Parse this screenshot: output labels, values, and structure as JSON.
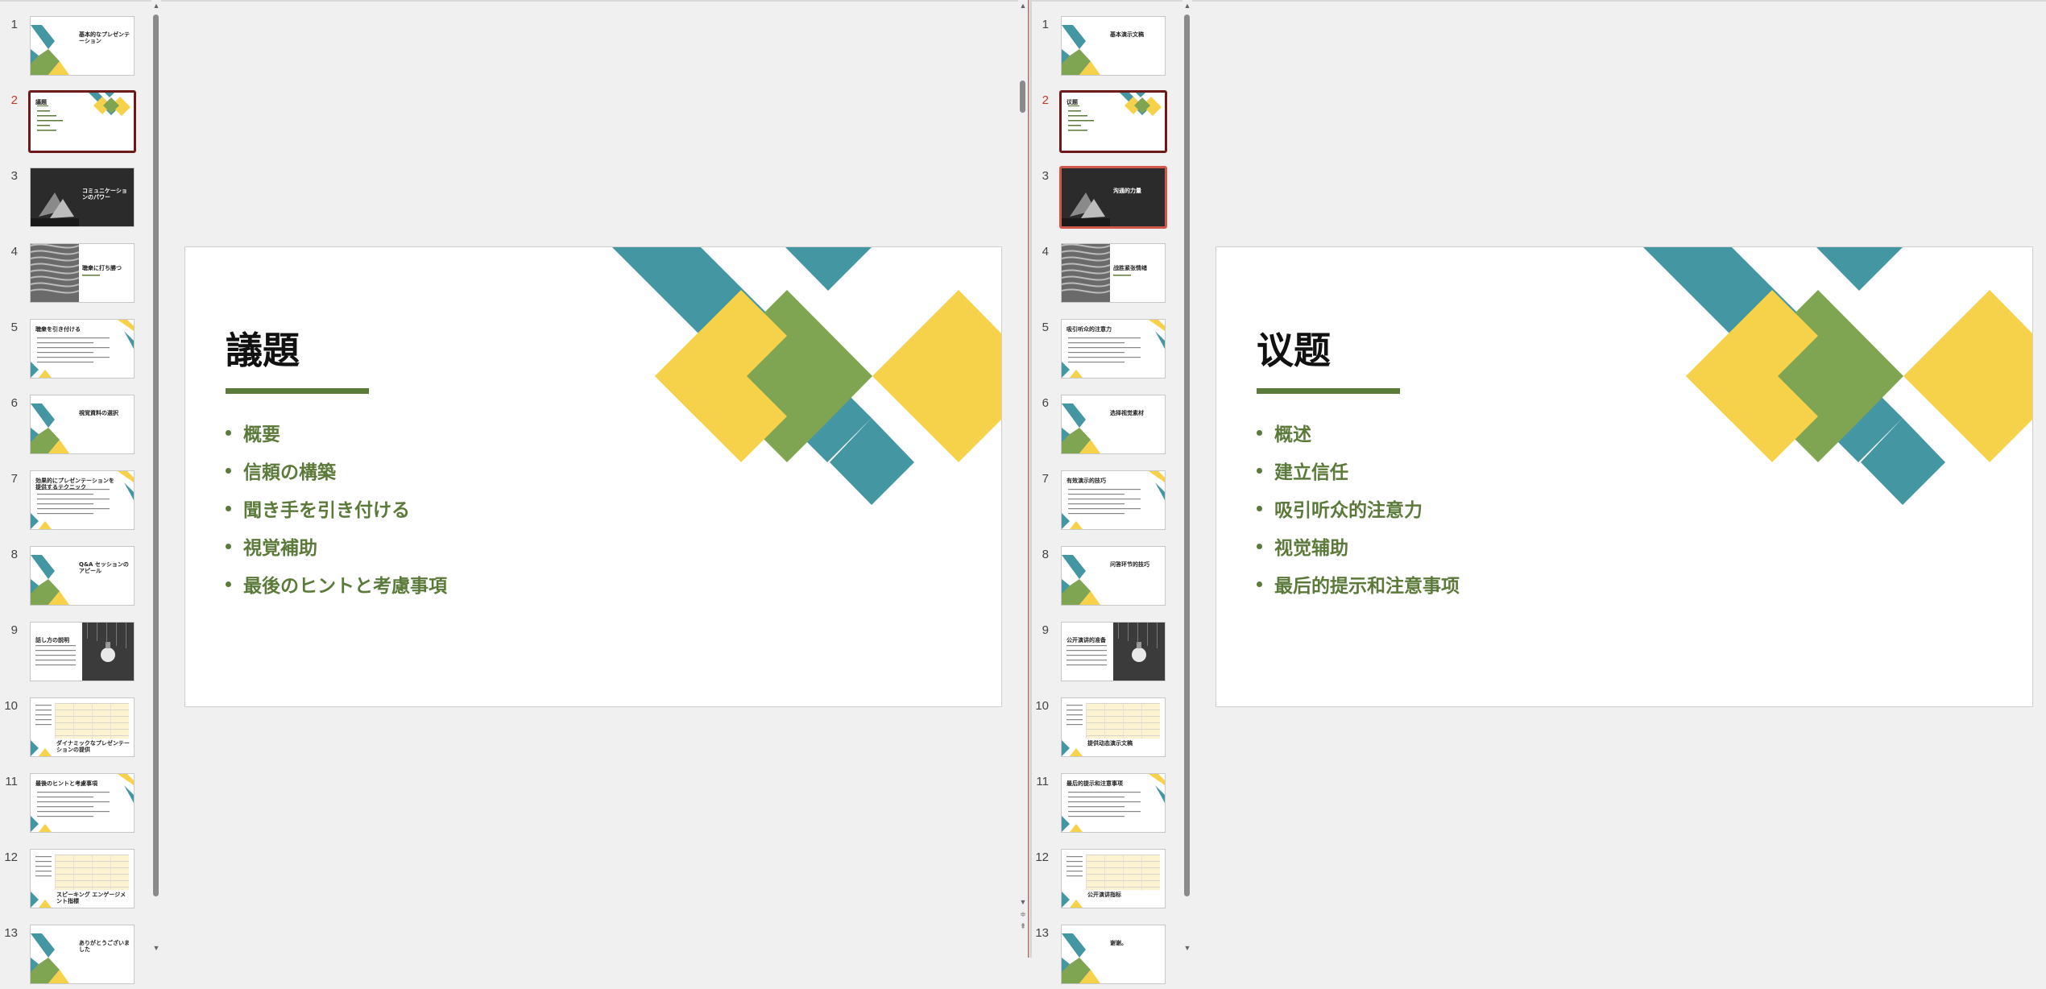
{
  "colors": {
    "teal": "#4596a3",
    "green": "#7fa552",
    "yellow": "#f6d24a",
    "olive": "#5b7a3a",
    "selected_border": "#6d1a1a"
  },
  "left": {
    "thumbnails": [
      {
        "num": "1",
        "title": "基本的なプレゼンテーション",
        "style": "shapes"
      },
      {
        "num": "2",
        "title": "議題",
        "style": "agenda",
        "selected": true
      },
      {
        "num": "3",
        "title": "コミュニケーションのパワー",
        "style": "dark"
      },
      {
        "num": "4",
        "title": "聴衆に打ち勝つ",
        "style": "photo"
      },
      {
        "num": "5",
        "title": "聴衆を引き付ける",
        "style": "text"
      },
      {
        "num": "6",
        "title": "視覚資料の選択",
        "style": "shapes"
      },
      {
        "num": "7",
        "title": "効果的にプレゼンテーションを提供するテクニック",
        "style": "text"
      },
      {
        "num": "8",
        "title": "Q&A セッションのアピール",
        "style": "shapes"
      },
      {
        "num": "9",
        "title": "話し方の説明",
        "style": "bulb"
      },
      {
        "num": "10",
        "title": "ダイナミックなプレゼンテーションの提供",
        "style": "table"
      },
      {
        "num": "11",
        "title": "最後のヒントと考慮事項",
        "style": "text"
      },
      {
        "num": "12",
        "title": "スピーキング エンゲージメント指標",
        "style": "table"
      },
      {
        "num": "13",
        "title": "ありがとうございました",
        "style": "shapes"
      }
    ],
    "slide": {
      "title": "議題",
      "bullets": [
        "概要",
        "信頼の構築",
        "聞き手を引き付ける",
        "視覚補助",
        "最後のヒントと考慮事項"
      ]
    }
  },
  "right": {
    "thumbnails": [
      {
        "num": "1",
        "title": "基本演示文稿",
        "style": "shapes"
      },
      {
        "num": "2",
        "title": "议题",
        "style": "agenda",
        "selected": true
      },
      {
        "num": "3",
        "title": "沟通的力量",
        "style": "dark",
        "selected_alt": true
      },
      {
        "num": "4",
        "title": "战胜紧张情绪",
        "style": "photo"
      },
      {
        "num": "5",
        "title": "吸引听众的注意力",
        "style": "text"
      },
      {
        "num": "6",
        "title": "选择视觉素材",
        "style": "shapes"
      },
      {
        "num": "7",
        "title": "有效演示的技巧",
        "style": "text"
      },
      {
        "num": "8",
        "title": "问答环节的技巧",
        "style": "shapes"
      },
      {
        "num": "9",
        "title": "公开演讲的准备",
        "style": "bulb"
      },
      {
        "num": "10",
        "title": "提供动态演示文稿",
        "style": "table"
      },
      {
        "num": "11",
        "title": "最后的提示和注意事项",
        "style": "text"
      },
      {
        "num": "12",
        "title": "公开演讲指标",
        "style": "table"
      },
      {
        "num": "13",
        "title": "谢谢。",
        "style": "shapes"
      }
    ],
    "slide": {
      "title": "议题",
      "bullets": [
        "概述",
        "建立信任",
        "吸引听众的注意力",
        "视觉辅助",
        "最后的提示和注意事项"
      ]
    }
  },
  "icons": {
    "scroll_up": "scroll-up-icon",
    "scroll_down": "scroll-down-icon",
    "split": "split-view-icon"
  }
}
